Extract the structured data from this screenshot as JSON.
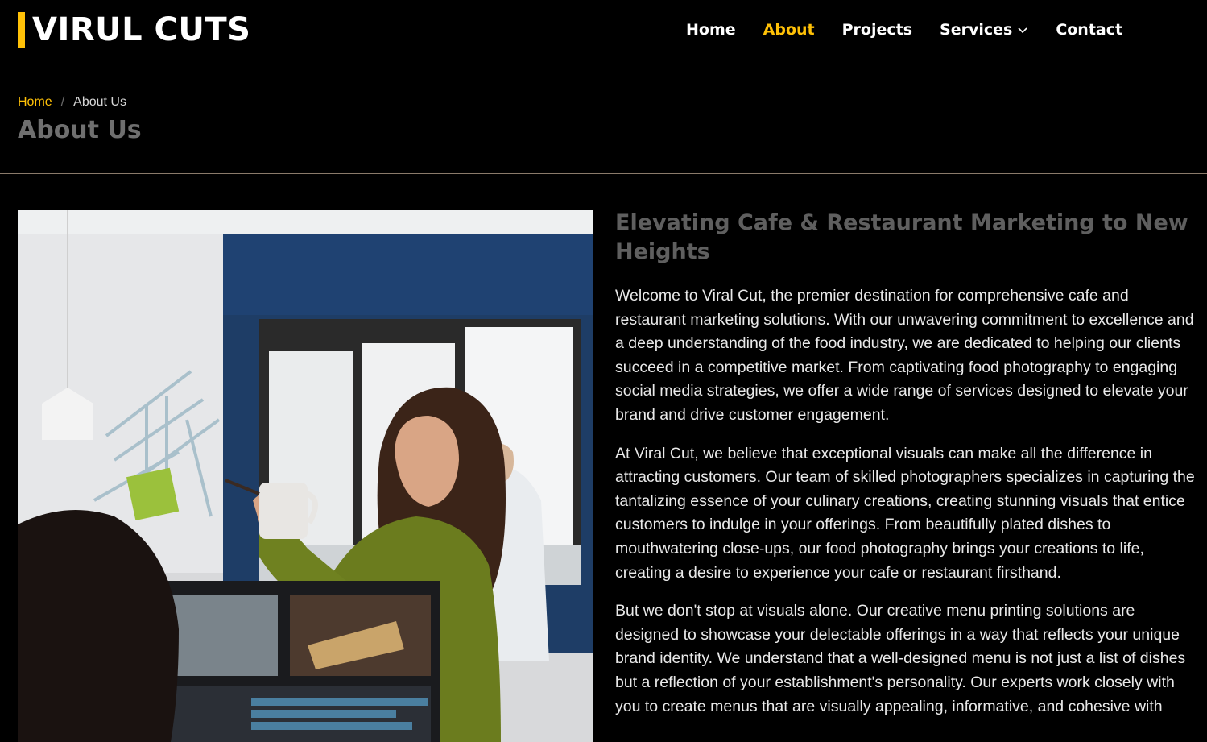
{
  "header": {
    "logo_text": "VIRUL CUTS",
    "brand_color": "#ffc107",
    "nav": [
      {
        "label": "Home",
        "active": false
      },
      {
        "label": "About",
        "active": true
      },
      {
        "label": "Projects",
        "active": false
      },
      {
        "label": "Services",
        "active": false,
        "has_dropdown": true
      },
      {
        "label": "Contact",
        "active": false
      }
    ],
    "dropdown_icon": "chevron-down-icon"
  },
  "breadcrumb": {
    "home": "Home",
    "separator": "/",
    "current": "About Us"
  },
  "page_title": "About Us",
  "about": {
    "image_description_icon": "photo-icon",
    "heading": "Elevating Cafe & Restaurant Marketing to New Heights",
    "paragraphs": [
      "Welcome to Viral Cut, the premier destination for comprehensive cafe and restaurant marketing solutions. With our unwavering commitment to excellence and a deep understanding of the food industry, we are dedicated to helping our clients succeed in a competitive market. From captivating food photography to engaging social media strategies, we offer a wide range of services designed to elevate your brand and drive customer engagement.",
      "At Viral Cut, we believe that exceptional visuals can make all the difference in attracting customers. Our team of skilled photographers specializes in capturing the tantalizing essence of your culinary creations, creating stunning visuals that entice customers to indulge in your offerings. From beautifully plated dishes to mouthwatering close-ups, our food photography brings your creations to life, creating a desire to experience your cafe or restaurant firsthand.",
      "But we don't stop at visuals alone. Our creative menu printing solutions are designed to showcase your delectable offerings in a way that reflects your unique brand identity. We understand that a well-designed menu is not just a list of dishes but a reflection of your establishment's personality. Our experts work closely with you to create menus that are visually appealing, informative, and cohesive with"
    ]
  }
}
